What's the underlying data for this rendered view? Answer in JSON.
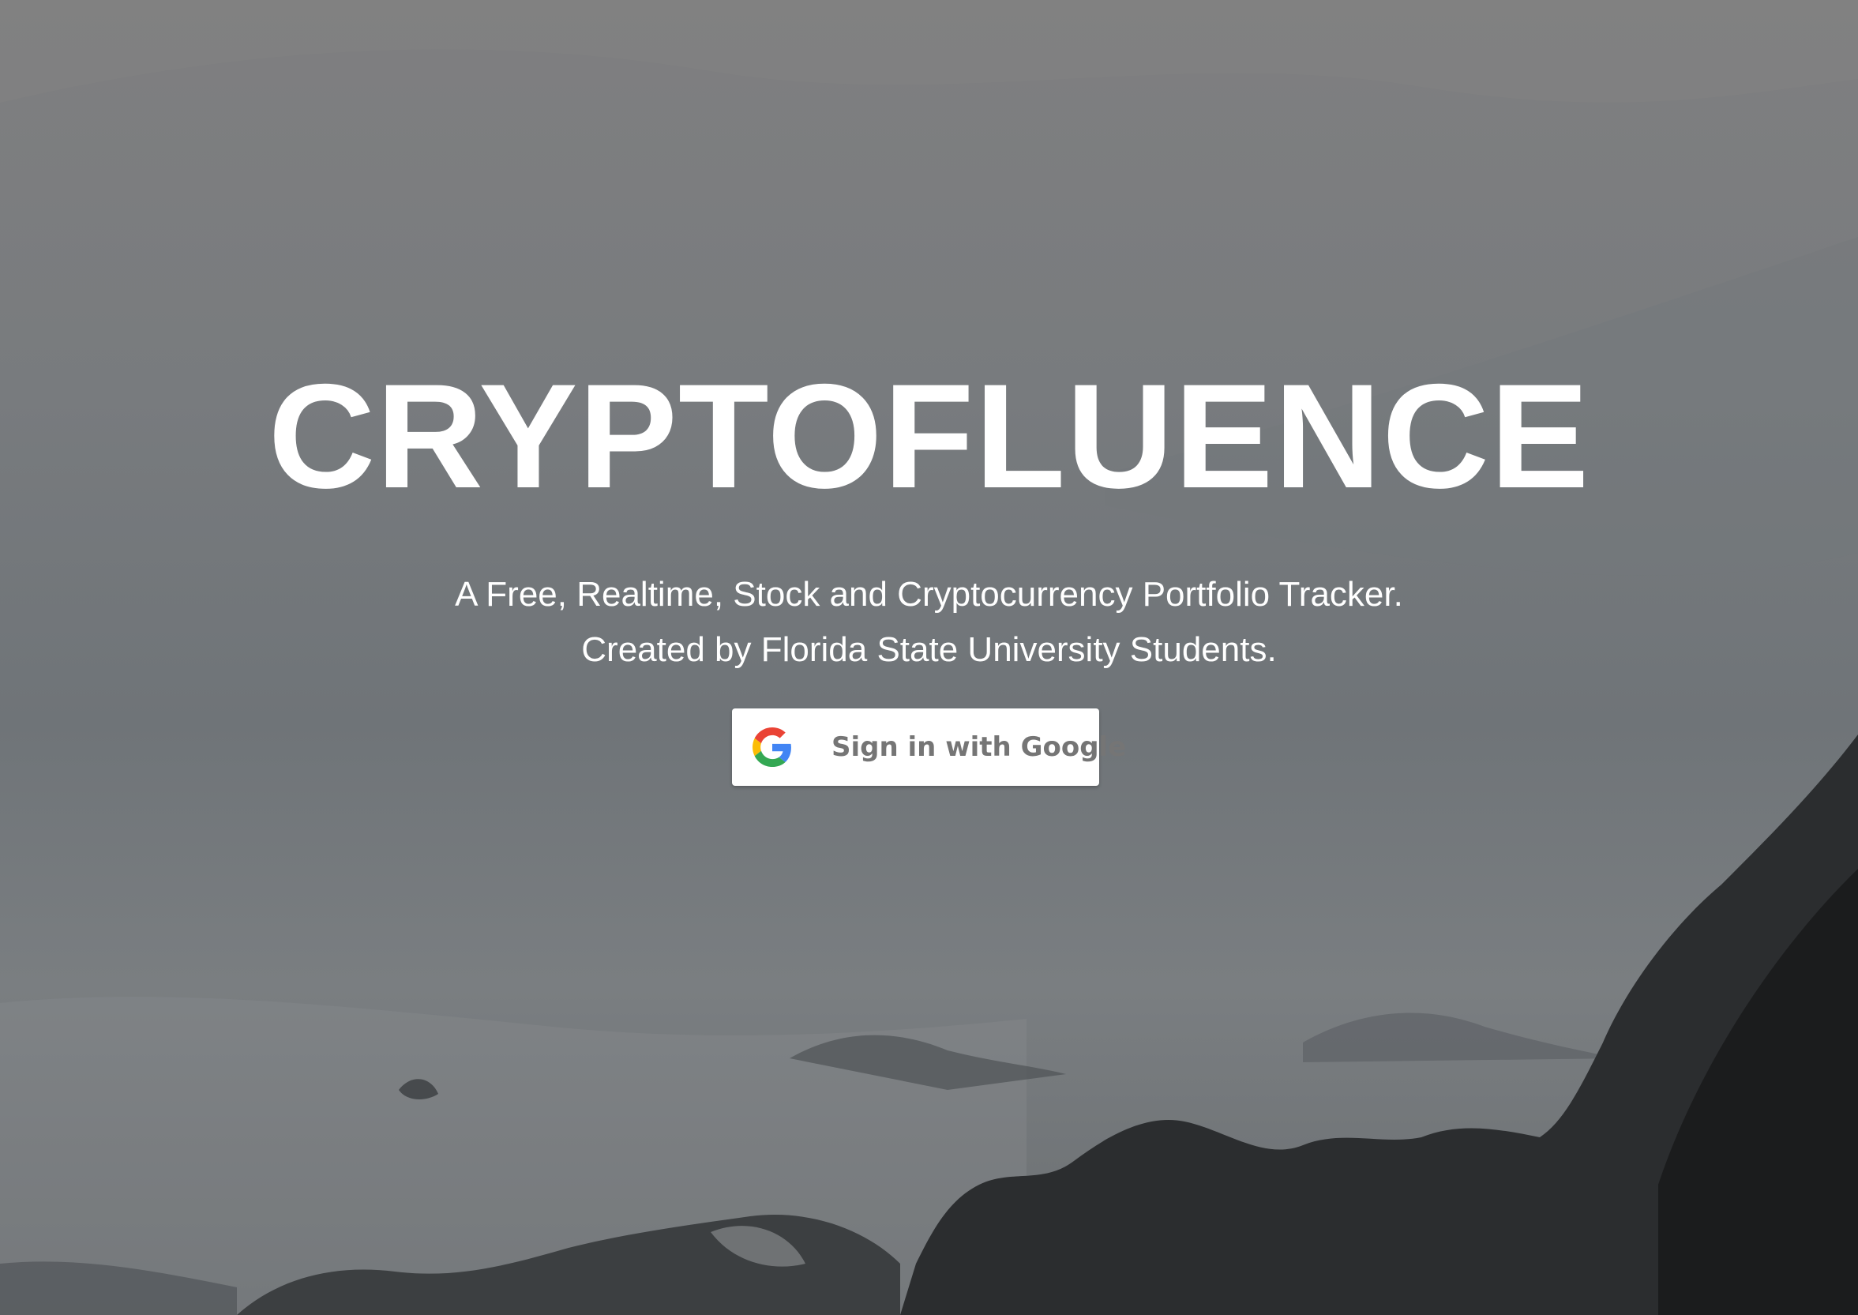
{
  "hero": {
    "title": "CRYPTOFLUENCE",
    "tagline_line1": "A Free, Realtime, Stock and Cryptocurrency Portfolio Tracker.",
    "tagline_line2": "Created by Florida State University Students.",
    "background_icon": "misty-coastline-photo"
  },
  "auth": {
    "google_button_label": "Sign in with Google",
    "google_icon": "google-g-logo-icon"
  },
  "colors": {
    "title_text": "#ffffff",
    "button_bg": "#ffffff",
    "button_text": "#757575",
    "google_blue": "#4285F4",
    "google_red": "#EA4335",
    "google_yellow": "#FBBC05",
    "google_green": "#34A853"
  }
}
